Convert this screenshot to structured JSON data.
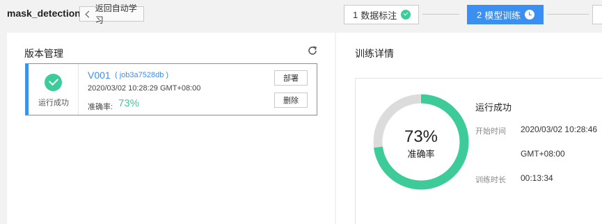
{
  "header": {
    "app_title": "mask_detection",
    "back_label": "返回自动学习",
    "steps": [
      {
        "number": "1",
        "label": "数据标注",
        "state": "done"
      },
      {
        "number": "2",
        "label": "模型训练",
        "state": "active"
      }
    ]
  },
  "colors": {
    "accent": "#3a8ff0",
    "success": "#3ecb9a",
    "ring_track": "#dcdcdc"
  },
  "version_panel": {
    "title": "版本管理",
    "versions": [
      {
        "status": "运行成功",
        "name": "V001",
        "job": "( job3a7528db )",
        "time": "2020/03/02 10:28:29 GMT+08:00",
        "accuracy_label": "准确率:",
        "accuracy": "73%",
        "deploy_label": "部署",
        "delete_label": "删除"
      }
    ]
  },
  "detail_panel": {
    "title": "训练详情",
    "accuracy_fraction": 0.73,
    "accuracy_text": "73%",
    "accuracy_label": "准确率",
    "status": "运行成功",
    "start_time_key": "开始时间",
    "start_time_value": "2020/03/02 10:28:46",
    "start_time_tz": "GMT+08:00",
    "duration_key": "训练时长",
    "duration_value": "00:13:34"
  }
}
